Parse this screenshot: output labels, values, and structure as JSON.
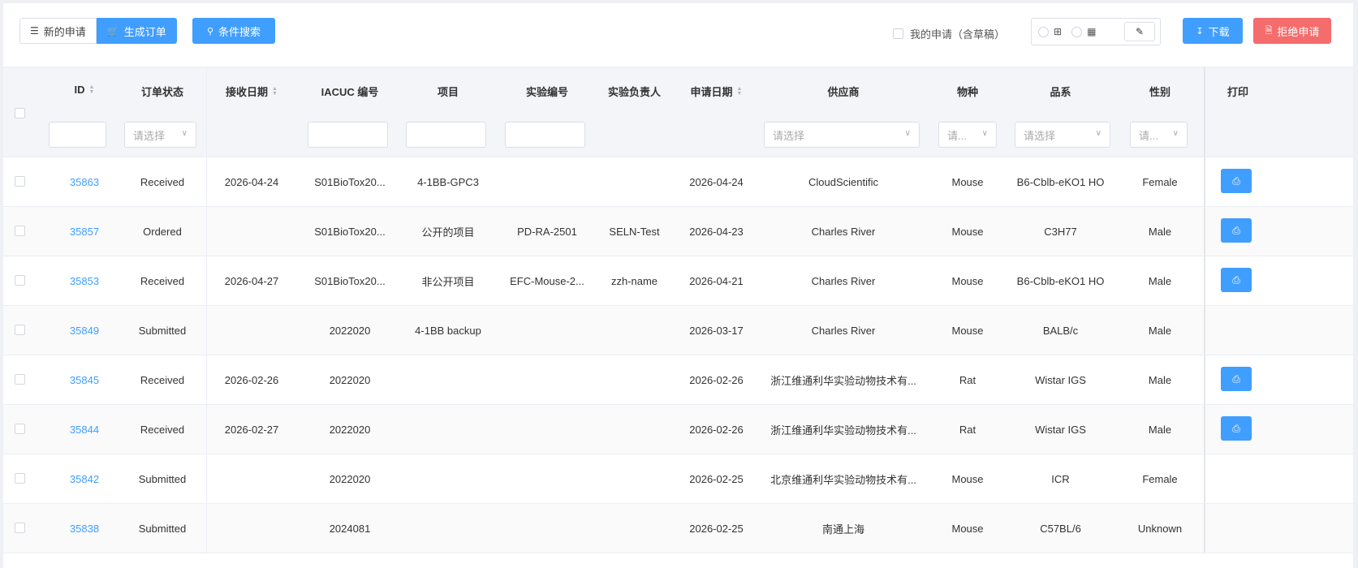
{
  "toolbar": {
    "new_request_label": "新的申请",
    "generate_order_label": "生成订单",
    "search_label": "条件搜索",
    "my_requests_label": "我的申请（含草稿）",
    "download_label": "下载",
    "reject_label": "拒绝申请"
  },
  "table": {
    "headers": {
      "id": "ID",
      "status": "订单状态",
      "received_date": "接收日期",
      "iacuc": "IACUC 编号",
      "project": "项目",
      "experiment_no": "实验编号",
      "experiment_lead": "实验负责人",
      "apply_date": "申请日期",
      "supplier": "供应商",
      "species": "物种",
      "strain": "品系",
      "sex": "性别",
      "print": "打印"
    },
    "filters": {
      "status_placeholder": "请选择",
      "supplier_placeholder": "请选择",
      "species_placeholder": "请...",
      "strain_placeholder": "请选择",
      "sex_placeholder": "请..."
    },
    "rows": [
      {
        "id": "35863",
        "status": "Received",
        "received_date": "2026-04-24",
        "iacuc": "S01BioTox20...",
        "project": "4-1BB-GPC3",
        "experiment_no": "",
        "experiment_lead": "",
        "apply_date": "2026-04-24",
        "supplier": "CloudScientific",
        "species": "Mouse",
        "strain": "B6-Cblb-eKO1 HO",
        "sex": "Female",
        "printable": true
      },
      {
        "id": "35857",
        "status": "Ordered",
        "received_date": "",
        "iacuc": "S01BioTox20...",
        "project": "公开的项目",
        "experiment_no": "PD-RA-2501",
        "experiment_lead": "SELN-Test",
        "apply_date": "2026-04-23",
        "supplier": "Charles River",
        "species": "Mouse",
        "strain": "C3H77",
        "sex": "Male",
        "printable": true
      },
      {
        "id": "35853",
        "status": "Received",
        "received_date": "2026-04-27",
        "iacuc": "S01BioTox20...",
        "project": "非公开项目",
        "experiment_no": "EFC-Mouse-2...",
        "experiment_lead": "zzh-name",
        "apply_date": "2026-04-21",
        "supplier": "Charles River",
        "species": "Mouse",
        "strain": "B6-Cblb-eKO1 HO",
        "sex": "Male",
        "printable": true
      },
      {
        "id": "35849",
        "status": "Submitted",
        "received_date": "",
        "iacuc": "2022020",
        "project": "4-1BB backup",
        "experiment_no": "",
        "experiment_lead": "",
        "apply_date": "2026-03-17",
        "supplier": "Charles River",
        "species": "Mouse",
        "strain": "BALB/c",
        "sex": "Male",
        "printable": false
      },
      {
        "id": "35845",
        "status": "Received",
        "received_date": "2026-02-26",
        "iacuc": "2022020",
        "project": "",
        "experiment_no": "",
        "experiment_lead": "",
        "apply_date": "2026-02-26",
        "supplier": "浙江维通利华实验动物技术有...",
        "species": "Rat",
        "strain": "Wistar IGS",
        "sex": "Male",
        "printable": true
      },
      {
        "id": "35844",
        "status": "Received",
        "received_date": "2026-02-27",
        "iacuc": "2022020",
        "project": "",
        "experiment_no": "",
        "experiment_lead": "",
        "apply_date": "2026-02-26",
        "supplier": "浙江维通利华实验动物技术有...",
        "species": "Rat",
        "strain": "Wistar IGS",
        "sex": "Male",
        "printable": true
      },
      {
        "id": "35842",
        "status": "Submitted",
        "received_date": "",
        "iacuc": "2022020",
        "project": "",
        "experiment_no": "",
        "experiment_lead": "",
        "apply_date": "2026-02-25",
        "supplier": "北京维通利华实验动物技术有...",
        "species": "Mouse",
        "strain": "ICR",
        "sex": "Female",
        "printable": false
      },
      {
        "id": "35838",
        "status": "Submitted",
        "received_date": "",
        "iacuc": "2024081",
        "project": "",
        "experiment_no": "",
        "experiment_lead": "",
        "apply_date": "2026-02-25",
        "supplier": "南通上海",
        "species": "Mouse",
        "strain": "C57BL/6",
        "sex": "Unknown",
        "printable": false
      }
    ]
  },
  "colors": {
    "primary": "#409eff",
    "danger": "#f56c6c",
    "link": "#409eff"
  }
}
